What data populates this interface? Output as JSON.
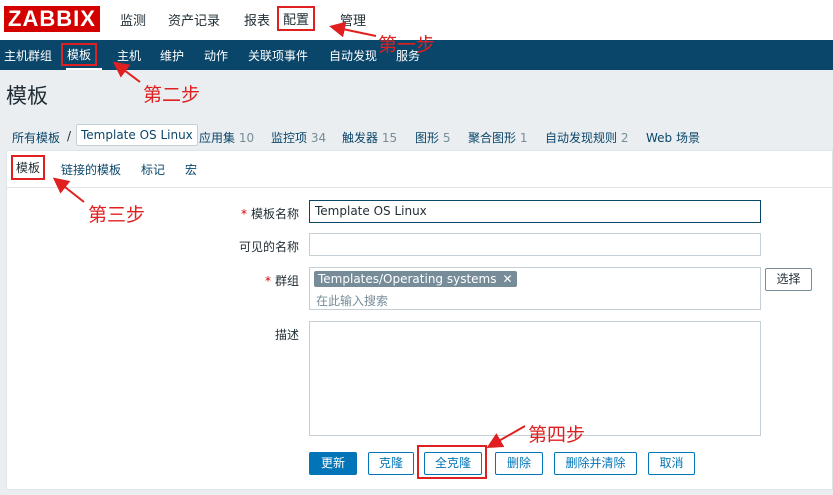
{
  "app": {
    "logo": "ZABBIX"
  },
  "top_menu": [
    "监测",
    "资产记录",
    "报表",
    "配置",
    "管理"
  ],
  "sub_menu": [
    "主机群组",
    "模板",
    "主机",
    "维护",
    "动作",
    "关联项事件",
    "自动发现",
    "服务"
  ],
  "page_title": "模板",
  "breadcrumb": {
    "all_templates": "所有模板",
    "separator": "/",
    "current": "Template OS Linux",
    "items": [
      {
        "label": "应用集",
        "count": "10"
      },
      {
        "label": "监控项",
        "count": "34"
      },
      {
        "label": "触发器",
        "count": "15"
      },
      {
        "label": "图形",
        "count": "5"
      },
      {
        "label": "聚合图形",
        "count": "1"
      },
      {
        "label": "自动发现规则",
        "count": "2"
      },
      {
        "label": "Web 场景",
        "count": ""
      }
    ]
  },
  "tabs": [
    "模板",
    "链接的模板",
    "标记",
    "宏"
  ],
  "form": {
    "template_name_label": "模板名称",
    "template_name_value": "Template OS Linux",
    "visible_name_label": "可见的名称",
    "visible_name_value": "",
    "groups_label": "群组",
    "group_chip": "Templates/Operating systems",
    "group_placeholder": "在此输入搜索",
    "select_button": "选择",
    "description_label": "描述",
    "description_value": "",
    "required_mark": "*"
  },
  "buttons": {
    "update": "更新",
    "clone": "克隆",
    "full_clone": "全克隆",
    "delete": "删除",
    "delete_and_clear": "删除并清除",
    "cancel": "取消"
  },
  "annotations": {
    "step1": "第一步",
    "step2": "第二步",
    "step3": "第三步",
    "step4": "第四步"
  },
  "colors": {
    "brand_red": "#d40000",
    "nav_blue": "#0a466a",
    "primary_button": "#0275b8",
    "annotation_red": "#e02020"
  }
}
